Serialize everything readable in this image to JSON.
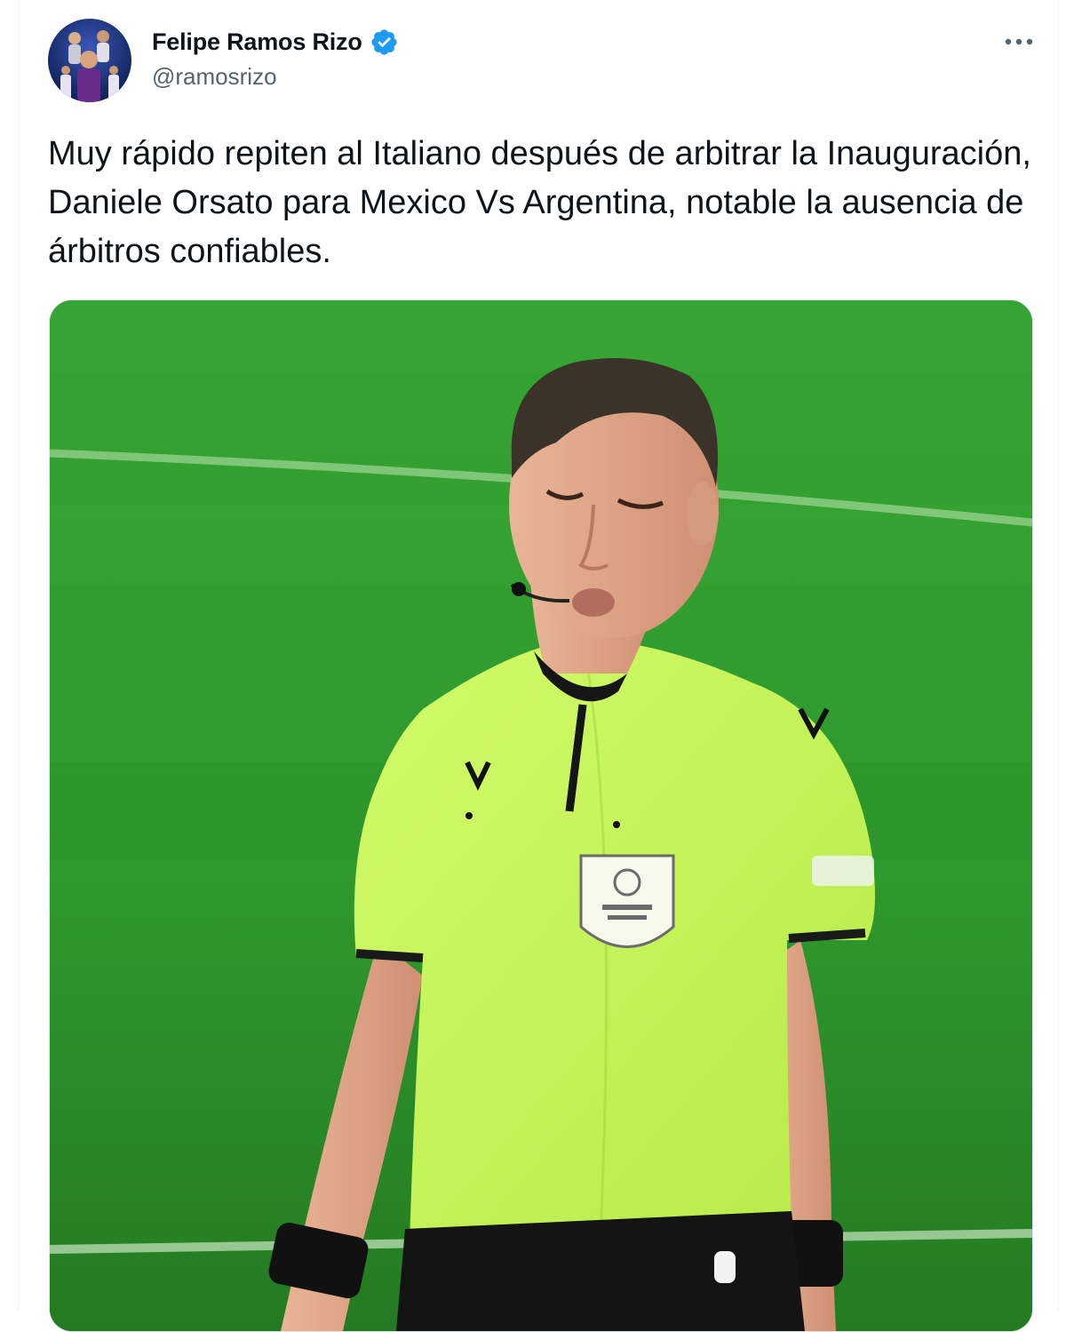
{
  "tweet": {
    "author": {
      "display_name": "Felipe Ramos Rizo",
      "handle": "@ramosrizo",
      "verified": true,
      "verified_icon": "verified-badge-icon",
      "avatar": "avatar-photo"
    },
    "more_icon": "more-options-icon",
    "text": "Muy rápido repiten al Italiano después de arbitrar la Inauguración, Daniele Orsato para Mexico Vs Argentina, notable la ausencia de árbitros confiables.",
    "media": {
      "type": "photo",
      "description_icon": "referee-photo"
    }
  },
  "colors": {
    "verified": "#1d9bf0",
    "secondary_text": "#536471",
    "pitch": "#2f8f2c",
    "jersey": "#c9f55a"
  }
}
